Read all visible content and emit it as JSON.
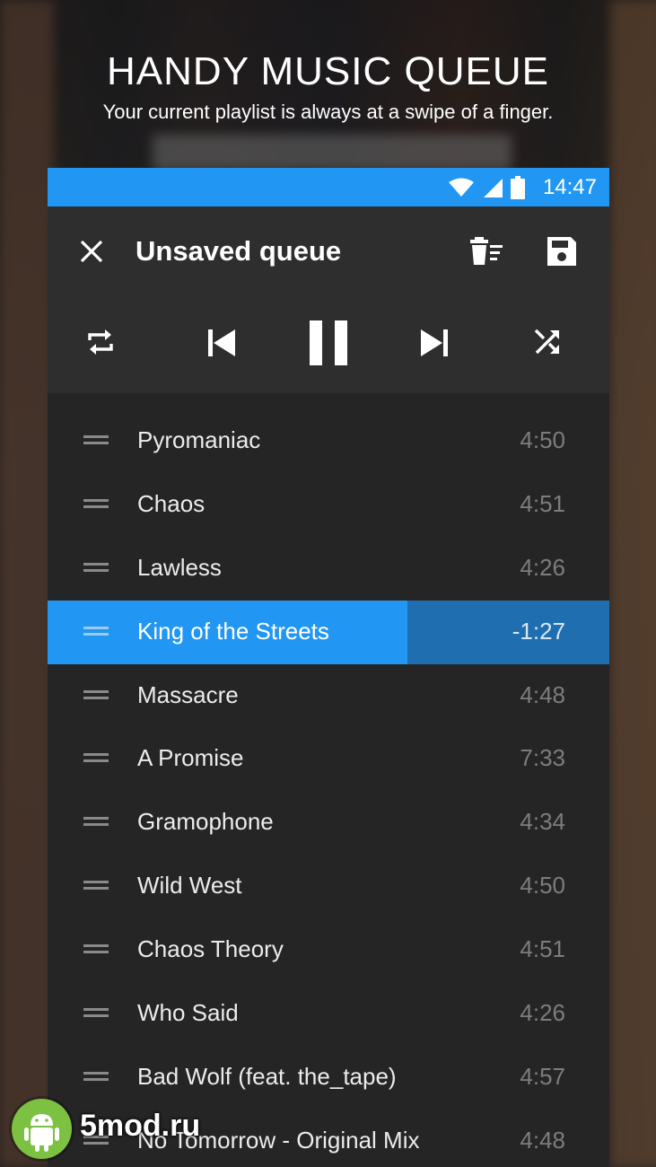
{
  "promo": {
    "headline": "HANDY MUSIC QUEUE",
    "subline": "Your current playlist is always at a swipe of a finger."
  },
  "status_bar": {
    "time": "14:47",
    "icons": [
      "wifi-icon",
      "cellular-signal-icon",
      "battery-icon"
    ],
    "color": "#2196f3"
  },
  "toolbar": {
    "title": "Unsaved queue",
    "icons": [
      "close-icon",
      "clear-queue-icon",
      "save-icon"
    ]
  },
  "playback_controls": [
    "repeat-icon",
    "skip-previous-icon",
    "pause-icon",
    "skip-next-icon",
    "shuffle-icon"
  ],
  "queue": [
    {
      "title": "Pyromaniac",
      "duration": "4:50"
    },
    {
      "title": "Chaos",
      "duration": "4:51"
    },
    {
      "title": "Lawless",
      "duration": "4:26"
    },
    {
      "title": "King of the Streets",
      "duration": "-1:27",
      "playing": true,
      "progress": 0.64
    },
    {
      "title": "Massacre",
      "duration": "4:48"
    },
    {
      "title": "A Promise",
      "duration": "7:33"
    },
    {
      "title": "Gramophone",
      "duration": "4:34"
    },
    {
      "title": "Wild West",
      "duration": "4:50"
    },
    {
      "title": "Chaos Theory",
      "duration": "4:51"
    },
    {
      "title": "Who Said",
      "duration": "4:26"
    },
    {
      "title": "Bad Wolf (feat. the_tape)",
      "duration": "4:57"
    },
    {
      "title": "No Tomorrow - Original Mix",
      "duration": "4:48"
    }
  ],
  "accent_color": "#2196f3",
  "watermark": {
    "text": "5mod.ru",
    "icon": "android-icon"
  }
}
